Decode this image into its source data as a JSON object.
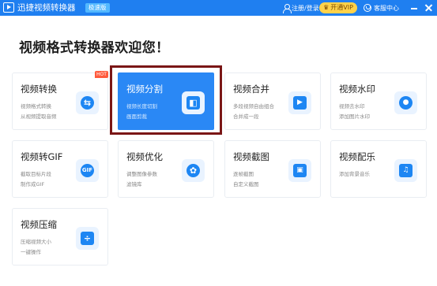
{
  "app": {
    "title": "迅捷视频转换器",
    "edition_badge": "极速版",
    "login_label": "注册/登录",
    "vip_label": "开通VIP",
    "help_label": "客服中心"
  },
  "main": {
    "welcome": "视频格式转换器欢迎您！",
    "hot_badge": "HOT"
  },
  "cards": [
    {
      "title": "视频转换",
      "desc1": "视频格式转换",
      "desc2": "从视频提取音频",
      "icon": "convert-icon",
      "glyph": "⇆"
    },
    {
      "title": "视频分割",
      "desc1": "视频长度切割",
      "desc2": "画面剪裁",
      "icon": "split-icon",
      "glyph": "◧",
      "active": true
    },
    {
      "title": "视频合并",
      "desc1": "多段视频自由组合",
      "desc2": "合并成一段",
      "icon": "merge-icon",
      "glyph": "▶"
    },
    {
      "title": "视频水印",
      "desc1": "视频去水印",
      "desc2": "添加图片水印",
      "icon": "watermark-stamp-icon",
      "glyph": "●"
    },
    {
      "title": "视频转GIF",
      "desc1": "截取目标片段",
      "desc2": "制作成GIF",
      "icon": "gif-icon",
      "glyph": "GIF"
    },
    {
      "title": "视频优化",
      "desc1": "调整图像参数",
      "desc2": "滤镜库",
      "icon": "film-reel-icon",
      "glyph": "✿"
    },
    {
      "title": "视频截图",
      "desc1": "逐帧截图",
      "desc2": "自定义截图",
      "icon": "screenshot-image-icon",
      "glyph": "▣"
    },
    {
      "title": "视频配乐",
      "desc1": "添加背景音乐",
      "desc2": "",
      "icon": "music-note-icon",
      "glyph": "♫"
    },
    {
      "title": "视频压缩",
      "desc1": "压缩视频大小",
      "desc2": "一键操作",
      "icon": "compress-icon",
      "glyph": "÷"
    }
  ],
  "colors": {
    "titlebar": "#1f7ff0",
    "accent": "#2a88f5",
    "vip": "#ffd24a",
    "hot": "#ff5a3c",
    "highlight_frame": "#7a1616"
  }
}
